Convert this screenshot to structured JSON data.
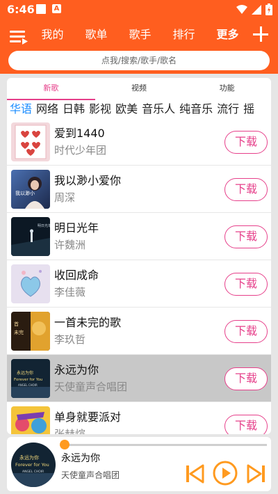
{
  "status": {
    "time": "6:46",
    "icon2_letter": "A"
  },
  "header": {
    "tabs": [
      {
        "label": "我的",
        "active": false
      },
      {
        "label": "歌单",
        "active": false
      },
      {
        "label": "歌手",
        "active": false
      },
      {
        "label": "排行",
        "active": false
      },
      {
        "label": "更多",
        "active": true
      }
    ],
    "search_placeholder": "点我/搜索/歌手/歌名"
  },
  "sub_tabs": [
    {
      "label": "新歌",
      "active": true
    },
    {
      "label": "视频",
      "active": false
    },
    {
      "label": "功能",
      "active": false
    }
  ],
  "genres": [
    {
      "label": "华语",
      "active": true
    },
    {
      "label": "网络",
      "active": false
    },
    {
      "label": "日韩",
      "active": false
    },
    {
      "label": "影视",
      "active": false
    },
    {
      "label": "欧美",
      "active": false
    },
    {
      "label": "音乐人",
      "active": false
    },
    {
      "label": "纯音乐",
      "active": false
    },
    {
      "label": "流行",
      "active": false
    },
    {
      "label": "摇",
      "active": false
    }
  ],
  "download_label": "下载",
  "songs": [
    {
      "title": "爱到1440",
      "artist": "时代少年团",
      "selected": false
    },
    {
      "title": "我以渺小爱你",
      "artist": "周深",
      "selected": false
    },
    {
      "title": "明日光年",
      "artist": "许魏洲",
      "selected": false
    },
    {
      "title": "收回成命",
      "artist": "李佳薇",
      "selected": false
    },
    {
      "title": "一首未完的歌",
      "artist": "李玖哲",
      "selected": false
    },
    {
      "title": "永远为你",
      "artist": "天使童声合唱团",
      "selected": true
    },
    {
      "title": "单身就要派对",
      "artist": "张赫煊",
      "selected": false
    }
  ],
  "player": {
    "title": "永远为你",
    "artist": "天使童声合唱团",
    "progress": 0.0
  },
  "colors": {
    "accent": "#ff5e1f",
    "download": "#e63f8a",
    "genre_active": "#1a8cff",
    "player_controls": "#ff9a1f"
  }
}
